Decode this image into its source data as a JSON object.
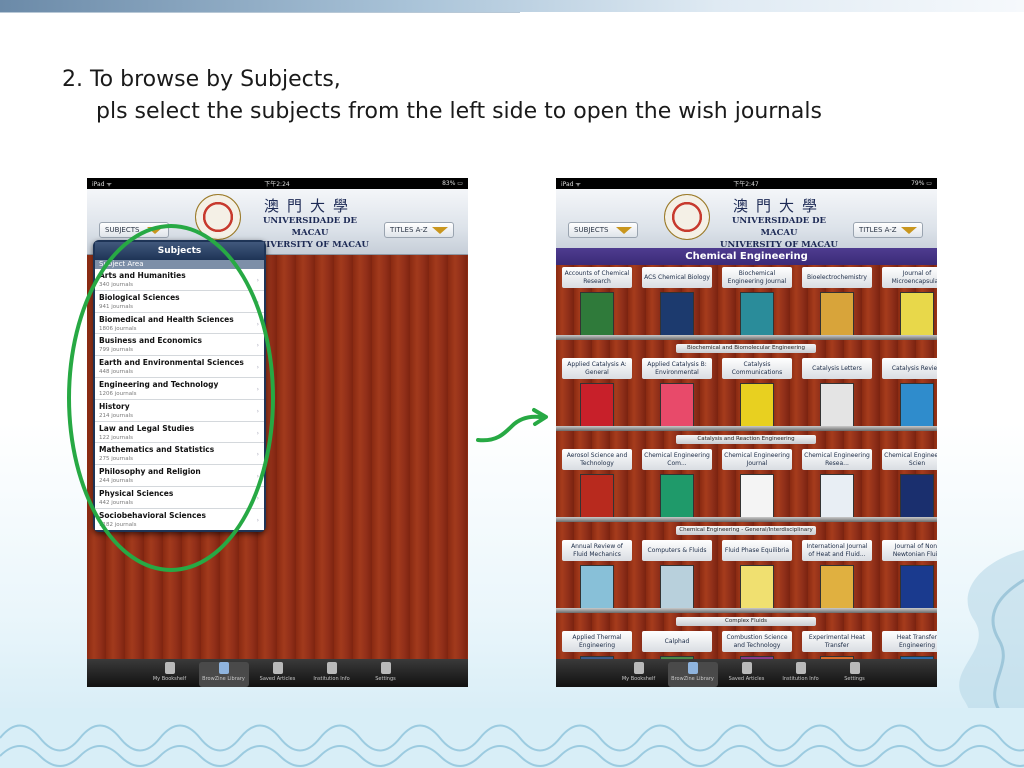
{
  "heading": {
    "line1": "2. To browse by Subjects,",
    "line2": "pls select the subjects from the left side to open the wish journals"
  },
  "left_screen": {
    "status": {
      "carrier": "iPad ᯤ",
      "time": "下午2:24",
      "battery": "83% ▭"
    },
    "banner": {
      "cn": "澳門大學",
      "pt": "UNIVERSIDADE DE MACAU",
      "en": "UNIVERSITY OF MACAU"
    },
    "subjects_button": "SUBJECTS",
    "titles_button": "TITLES A-Z",
    "popover": {
      "title": "Subjects",
      "section_header": "Subject Area",
      "items": [
        {
          "name": "Arts and Humanities",
          "count": "340 journals"
        },
        {
          "name": "Biological Sciences",
          "count": "941 journals"
        },
        {
          "name": "Biomedical and Health Sciences",
          "count": "1806 journals"
        },
        {
          "name": "Business and Economics",
          "count": "799 journals"
        },
        {
          "name": "Earth and Environmental Sciences",
          "count": "448 journals"
        },
        {
          "name": "Engineering and Technology",
          "count": "1206 journals"
        },
        {
          "name": "History",
          "count": "214 journals"
        },
        {
          "name": "Law and Legal Studies",
          "count": "122 journals"
        },
        {
          "name": "Mathematics and Statistics",
          "count": "275 journals"
        },
        {
          "name": "Philosophy and Religion",
          "count": "244 journals"
        },
        {
          "name": "Physical Sciences",
          "count": "442 journals"
        },
        {
          "name": "Sociobehavioral Sciences",
          "count": "1182 journals"
        }
      ]
    },
    "tabs": [
      "My Bookshelf",
      "BrowZine Library",
      "Saved Articles",
      "Institution Info",
      "Settings"
    ]
  },
  "right_screen": {
    "status": {
      "carrier": "iPad ᯤ",
      "time": "下午2:47",
      "battery": "79% ▭"
    },
    "banner": {
      "cn": "澳門大學",
      "pt": "UNIVERSIDADE DE MACAU",
      "en": "UNIVERSITY OF MACAU"
    },
    "subjects_button": "SUBJECTS",
    "titles_button": "TITLES A-Z",
    "category": "Chemical Engineering",
    "rows": [
      {
        "titles": [
          "Accounts of Chemical Research",
          "ACS Chemical Biology",
          "Biochemical Engineering Journal",
          "Bioelectrochemistry",
          "Journal of Microencapsulati"
        ],
        "section": "Biochemical and Biomolecular Engineering"
      },
      {
        "titles": [
          "Applied Catalysis A: General",
          "Applied Catalysis B: Environmental",
          "Catalysis Communications",
          "Catalysis Letters",
          "Catalysis Review"
        ],
        "section": "Catalysis and Reaction Engineering"
      },
      {
        "titles": [
          "Aerosol Science and Technology",
          "Chemical Engineering Com...",
          "Chemical Engineering Journal",
          "Chemical Engineering Resea...",
          "Chemical Engineering Scien"
        ],
        "section": "Chemical Engineering - General/Interdisciplinary"
      },
      {
        "titles": [
          "Annual Review of Fluid Mechanics",
          "Computers & Fluids",
          "Fluid Phase Equilibria",
          "International Journal of Heat and Fluid...",
          "Journal of Non-Newtonian Fluid"
        ],
        "section": "Complex Fluids"
      },
      {
        "titles": [
          "Applied Thermal Engineering",
          "Calphad",
          "Combustion Science and Technology",
          "Experimental Heat Transfer",
          "Heat Transfer Engineering"
        ],
        "section": ""
      }
    ],
    "tabs": [
      "My Bookshelf",
      "BrowZine Library",
      "Saved Articles",
      "Institution Info",
      "Settings"
    ]
  },
  "colors": {
    "highlight_ellipse": "#27a944",
    "category_bar": "#4e3c8f",
    "wood": "#9a3419"
  }
}
